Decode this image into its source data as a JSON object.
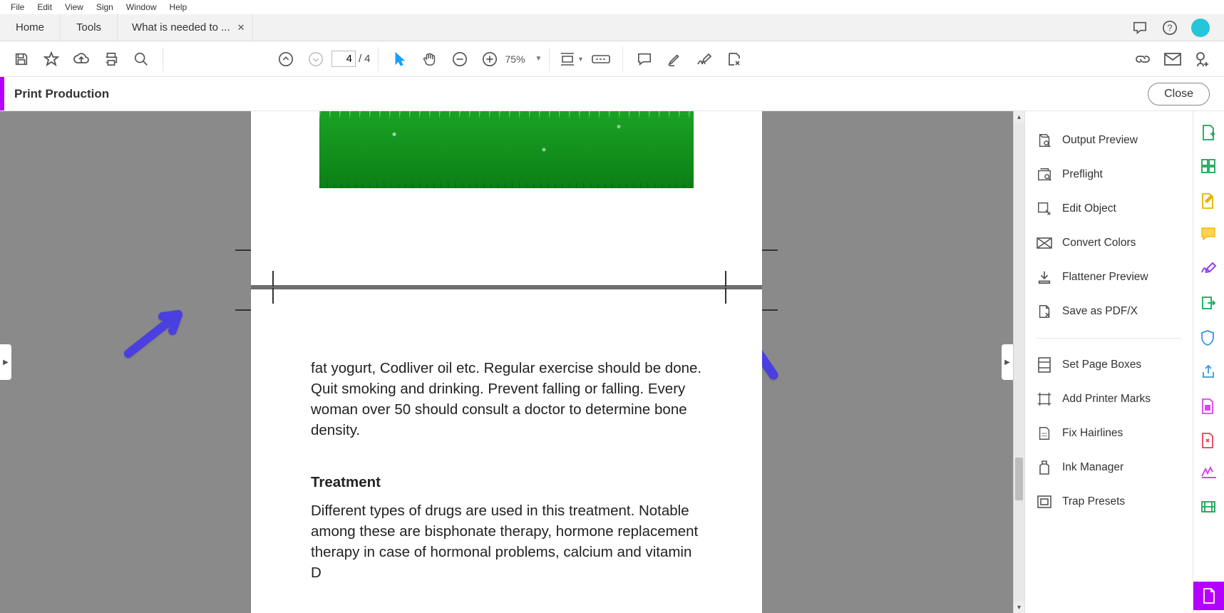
{
  "menu": {
    "file": "File",
    "edit": "Edit",
    "view": "View",
    "sign": "Sign",
    "window": "Window",
    "help": "Help"
  },
  "tabs": {
    "home": "Home",
    "tools": "Tools",
    "doc": "What is needed to ..."
  },
  "toolbar": {
    "page_current": "4",
    "page_sep": "/",
    "page_total": "4",
    "zoom": "75%"
  },
  "pp": {
    "title": "Print Production",
    "close": "Close"
  },
  "panel": {
    "output_preview": "Output Preview",
    "preflight": "Preflight",
    "edit_object": "Edit Object",
    "convert_colors": "Convert Colors",
    "flattener_preview": "Flattener Preview",
    "save_pdfx": "Save as PDF/X",
    "set_page_boxes": "Set Page Boxes",
    "add_printer_marks": "Add Printer Marks",
    "fix_hairlines": "Fix Hairlines",
    "ink_manager": "Ink Manager",
    "trap_presets": "Trap Presets"
  },
  "doc": {
    "para1": "fat yogurt, Codliver oil etc. Regular exercise should be done. Quit smoking and drinking. Prevent falling or falling. Every woman over 50 should consult a doctor to determine bone density.",
    "h_treatment": "Treatment",
    "para2": "Different types of drugs are used in this treatment. Notable among these are bisphonate therapy, hormone replacement therapy in case of hormonal problems, calcium and vitamin D"
  }
}
